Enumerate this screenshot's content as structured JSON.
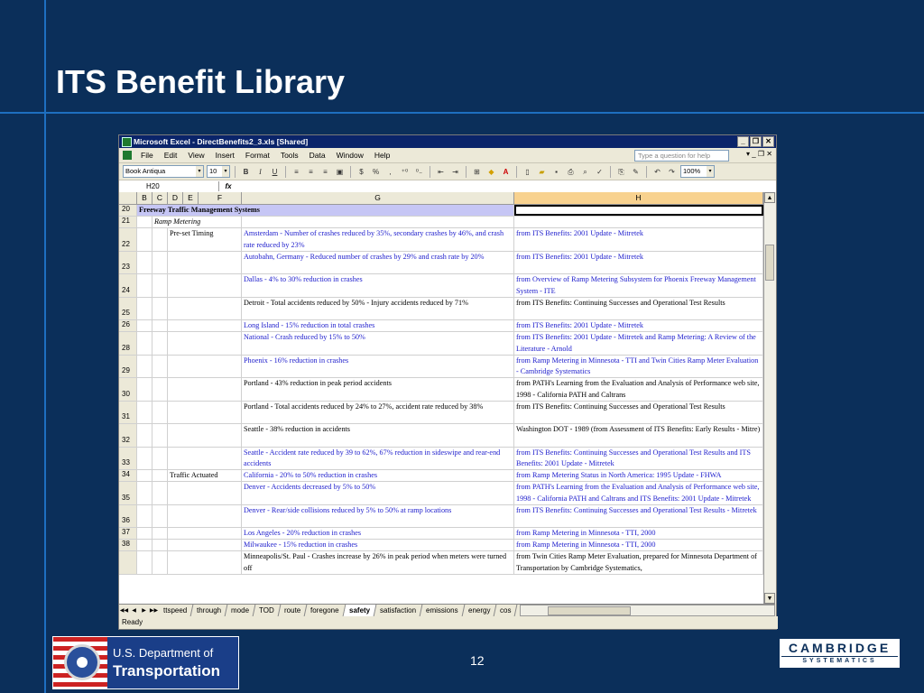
{
  "slide": {
    "title": "ITS Benefit Library",
    "page_number": "12",
    "dot_logo": {
      "line1": "U.S. Department of",
      "line2": "Transportation"
    },
    "cs_logo": {
      "line1": "CAMBRIDGE",
      "line2": "SYSTEMATICS"
    }
  },
  "excel": {
    "window_title": "Microsoft Excel - DirectBenefits2_3.xls  [Shared]",
    "menu": [
      "File",
      "Edit",
      "View",
      "Insert",
      "Format",
      "Tools",
      "Data",
      "Window",
      "Help"
    ],
    "help_placeholder": "Type a question for help",
    "font_name": "Book Antiqua",
    "font_size": "10",
    "zoom": "100%",
    "name_box": "H20",
    "fx_label": "fx",
    "toolbar_icons": [
      "bold-icon",
      "italic-icon",
      "underline-icon",
      "align-left-icon",
      "align-center-icon",
      "align-right-icon",
      "merge-icon",
      "currency-icon",
      "percent-icon",
      "comma-icon",
      "increase-decimal-icon",
      "decrease-decimal-icon",
      "decrease-indent-icon",
      "increase-indent-icon",
      "borders-icon",
      "fill-color-icon",
      "font-color-icon",
      "new-icon",
      "open-icon",
      "save-icon",
      "print-icon",
      "print-preview-icon",
      "spelling-icon",
      "paste-icon",
      "format-painter-icon",
      "undo-icon",
      "redo-icon"
    ],
    "toolbar_labels": {
      "bold": "B",
      "italic": "I",
      "underline": "U",
      "currency": "$",
      "percent": "%",
      "comma": ","
    },
    "columns": [
      "B",
      "C",
      "D",
      "E",
      "F",
      "G",
      "H"
    ],
    "rows": [
      {
        "n": "20",
        "f": "",
        "g": "Freeway Traffic Management Systems",
        "h": "",
        "header": true
      },
      {
        "n": "21",
        "f": "Ramp Metering",
        "g": "",
        "h": "",
        "sub": true
      },
      {
        "n": "22",
        "f": "Pre-set Timing",
        "g": "Amsterdam - Number of crashes reduced by 35%, secondary crashes by 46%, and crash rate reduced by 23%",
        "h": "from ITS Benefits:  2001 Update - Mitretek",
        "blue": true
      },
      {
        "n": "23",
        "f": "",
        "g": "Autobahn, Germany - Reduced number of crashes by 29% and crash rate by 20%",
        "h": "from ITS Benefits:  2001 Update - Mitretek",
        "blue": true
      },
      {
        "n": "24",
        "f": "",
        "g": "Dallas - 4% to 30% reduction in crashes",
        "h": "from Overview of Ramp Metering Subsystem for Phoenix Freeway Management System - ITE",
        "blue": true
      },
      {
        "n": "25",
        "f": "",
        "g": "Detroit - Total accidents reduced by 50% - Injury accidents reduced by 71%",
        "h": "from ITS Benefits: Continuing Successes and Operational Test Results",
        "blue": false
      },
      {
        "n": "26",
        "f": "",
        "g": "Long Island - 15% reduction in total crashes",
        "h": "from ITS Benefits:  2001 Update - Mitretek",
        "blue": true
      },
      {
        "n": "28",
        "f": "",
        "g": "National - Crash reduced by 15% to 50%",
        "h": "from ITS Benefits:  2001 Update - Mitretek and Ramp Metering:  A Review of the Literature - Arnold",
        "blue": true
      },
      {
        "n": "29",
        "f": "",
        "g": "Phoenix - 16% reduction in crashes",
        "h": "from Ramp Metering in Minnesota - TTI and Twin Cities Ramp Meter Evaluation - Cambridge Systematics",
        "blue": true
      },
      {
        "n": "30",
        "f": "",
        "g": "Portland - 43% reduction in peak period accidents",
        "h": "from PATH's Learning from the Evaluation and Analysis of Performance web site, 1998 - California PATH and Caltrans",
        "blue": false
      },
      {
        "n": "31",
        "f": "",
        "g": "Portland - Total accidents reduced by 24% to 27%, accident rate reduced by 38%",
        "h": "from ITS Benefits:  Continuing Successes and Operational Test Results",
        "blue": false
      },
      {
        "n": "32",
        "f": "",
        "g": "Seattle - 38% reduction in accidents",
        "h": "Washington DOT - 1989 (from Assessment of ITS Benefits:  Early Results - Mitre)",
        "blue": false
      },
      {
        "n": "33",
        "f": "",
        "g": "Seattle - Accident rate reduced by 39 to 62%, 67% reduction in sideswipe and rear-end accidents",
        "h": "from ITS Benefits: Continuing Successes and Operational Test Results and ITS Benefits:  2001 Update - Mitretek",
        "blue": true
      },
      {
        "n": "34",
        "f": "Traffic Actuated",
        "g": "California - 20% to 50% reduction in crashes",
        "h": "from Ramp Metering Status in North America:  1995 Update - FHWA",
        "blue": true
      },
      {
        "n": "35",
        "f": "",
        "g": "Denver - Accidents decreased by 5% to 50%",
        "h": "from PATH's Learning from the Evaluation and Analysis of Performance web site, 1998 - California PATH and Caltrans and ITS Benefits: 2001 Update - Mitretek",
        "blue": true
      },
      {
        "n": "36",
        "f": "",
        "g": "Denver - Rear/side collisions reduced by 5% to 50% at ramp locations",
        "h": "from ITS Benefits: Continuing Successes and Operational Test Results - Mitretek",
        "blue": true
      },
      {
        "n": "37",
        "f": "",
        "g": "Los Angeles - 20% reduction in crashes",
        "h": "from Ramp Metering in Minnesota - TTI, 2000",
        "blue": true
      },
      {
        "n": "38",
        "f": "",
        "g": "Milwaukee - 15% reduction in crashes",
        "h": "from Ramp Metering in Minnesota - TTI, 2000",
        "blue": true
      },
      {
        "n": "",
        "f": "",
        "g": "Minneapolis/St. Paul - Crashes increase by 26% in peak period when meters were turned off",
        "h": "from Twin Cities Ramp Meter Evaluation, prepared for Minnesota Department of Transportation by Cambridge Systematics,",
        "blue": false
      }
    ],
    "sheet_tabs": [
      "ttspeed",
      "through",
      "mode",
      "TOD",
      "route",
      "foregone",
      "safety",
      "satisfaction",
      "emissions",
      "energy",
      "cos"
    ],
    "active_tab": "safety",
    "status": "Ready"
  }
}
